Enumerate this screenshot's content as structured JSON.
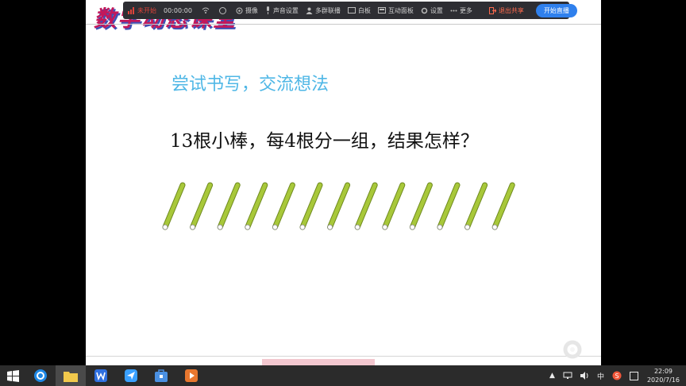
{
  "toolbar": {
    "record_label": "未开始",
    "timer": "00:00:00",
    "camera_label": "摄像",
    "audio_label": "声音设置",
    "camera_multi_label": "多群联播",
    "whiteboard_label": "白板",
    "interactive_label": "互动面板",
    "settings_label": "设置",
    "more_label": "更多",
    "exit_share_label": "退出共享",
    "start_live_label": "开始直播"
  },
  "slide": {
    "logo_text": "数学动态课堂",
    "heading": "尝试书写，交流想法",
    "question": "13根小棒，每4根分一组，结果怎样？",
    "stick_count": 13,
    "stick_color": "#a8c83a"
  },
  "taskbar": {
    "apps": [
      "search-app",
      "file-explorer",
      "wps-writer",
      "feishu",
      "bag-app",
      "slides-app"
    ],
    "ime_label": "中",
    "time": "22:09",
    "date": "2020/7/16"
  }
}
